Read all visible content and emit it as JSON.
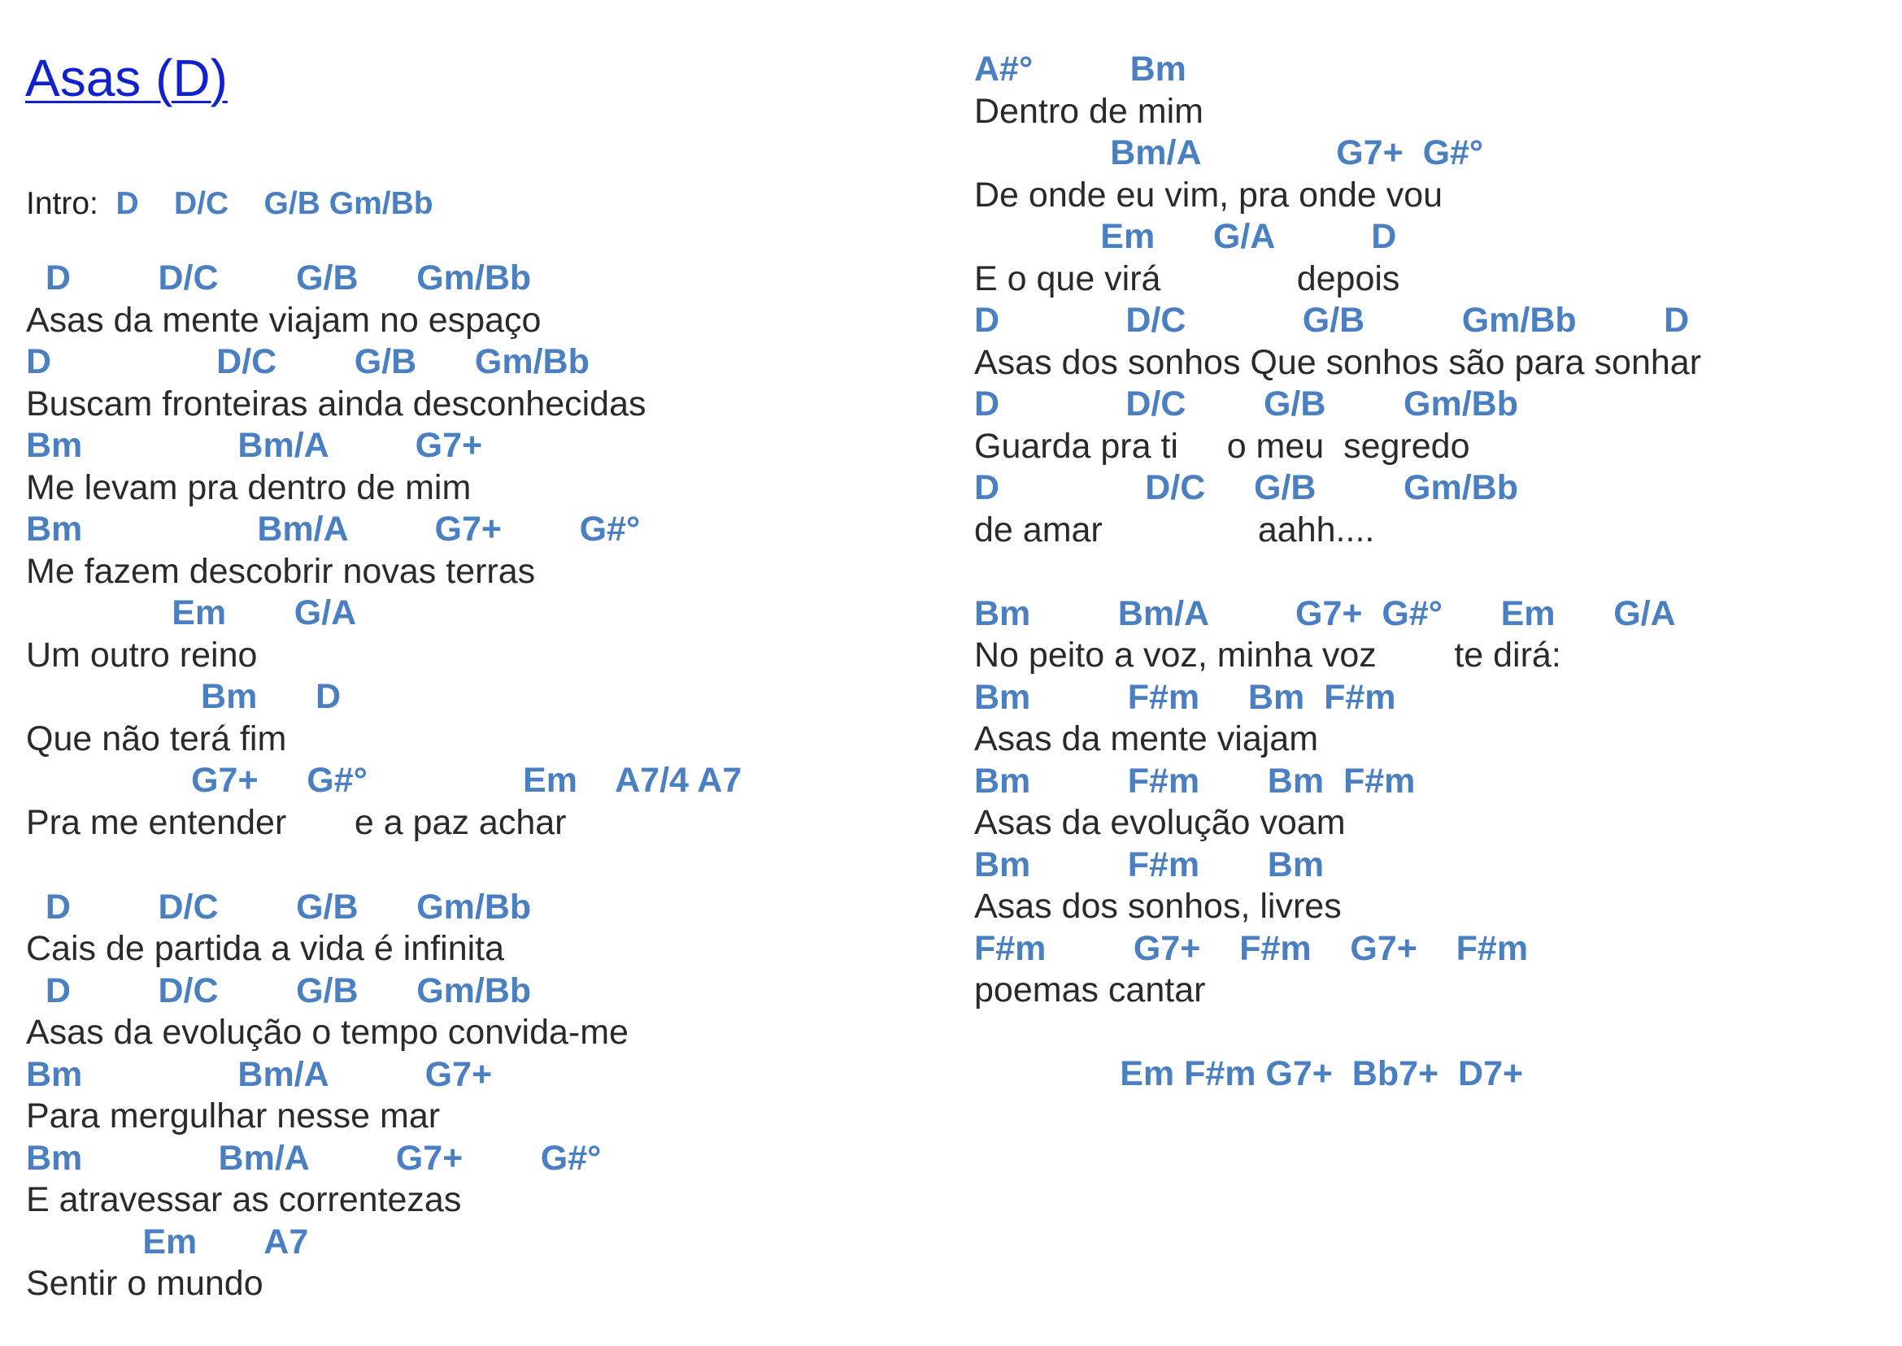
{
  "song": {
    "title": "Asas (D)",
    "intro_label": "Intro:  ",
    "intro_chords": "D    D/C    G/B Gm/Bb"
  },
  "left_column": [
    {
      "type": "chord",
      "text": "  D         D/C        G/B      Gm/Bb"
    },
    {
      "type": "lyric",
      "text": "Asas da mente viajam no espaço"
    },
    {
      "type": "chord",
      "text": "D                 D/C        G/B      Gm/Bb"
    },
    {
      "type": "lyric",
      "text": "Buscam fronteiras ainda desconhecidas"
    },
    {
      "type": "chord",
      "text": "Bm                Bm/A         G7+"
    },
    {
      "type": "lyric",
      "text": "Me levam pra dentro de mim"
    },
    {
      "type": "chord",
      "text": "Bm                  Bm/A         G7+        G#°"
    },
    {
      "type": "lyric",
      "text": "Me fazem descobrir novas terras"
    },
    {
      "type": "chord",
      "text": "               Em       G/A"
    },
    {
      "type": "lyric",
      "text": "Um outro reino"
    },
    {
      "type": "chord",
      "text": "                  Bm      D"
    },
    {
      "type": "lyric",
      "text": "Que não terá fim"
    },
    {
      "type": "chord",
      "text": "                 G7+     G#°                Em    A7/4 A7"
    },
    {
      "type": "lyric",
      "text": "Pra me entender       e a paz achar"
    },
    {
      "type": "chord",
      "text": "  D         D/C        G/B      Gm/Bb"
    },
    {
      "type": "lyric",
      "text": "Cais de partida a vida é infinita"
    },
    {
      "type": "chord",
      "text": "  D         D/C        G/B      Gm/Bb"
    },
    {
      "type": "lyric",
      "text": "Asas da evolução o tempo convida-me"
    },
    {
      "type": "chord",
      "text": "Bm                Bm/A          G7+"
    },
    {
      "type": "lyric",
      "text": "Para mergulhar nesse mar"
    },
    {
      "type": "chord",
      "text": "Bm              Bm/A         G7+        G#°"
    },
    {
      "type": "lyric",
      "text": "E atravessar as correntezas"
    },
    {
      "type": "chord",
      "text": "            Em       A7"
    },
    {
      "type": "lyric",
      "text": "Sentir o mundo"
    }
  ],
  "right_column": [
    {
      "type": "chord",
      "text": "A#°          Bm"
    },
    {
      "type": "lyric",
      "text": "Dentro de mim"
    },
    {
      "type": "chord",
      "text": "              Bm/A              G7+  G#°"
    },
    {
      "type": "lyric",
      "text": "De onde eu vim, pra onde vou"
    },
    {
      "type": "chord",
      "text": "             Em      G/A          D"
    },
    {
      "type": "lyric",
      "text": "E o que virá              depois"
    },
    {
      "type": "chord",
      "text": "D             D/C            G/B          Gm/Bb         D"
    },
    {
      "type": "lyric",
      "text": "Asas dos sonhos Que sonhos são para sonhar"
    },
    {
      "type": "chord",
      "text": "D             D/C        G/B        Gm/Bb"
    },
    {
      "type": "lyric",
      "text": "Guarda pra ti     o meu  segredo"
    },
    {
      "type": "chord",
      "text": "D               D/C     G/B         Gm/Bb"
    },
    {
      "type": "lyric",
      "text": "de amar                aahh...."
    },
    {
      "type": "chord",
      "text": "Bm         Bm/A         G7+  G#°      Em      G/A"
    },
    {
      "type": "lyric",
      "text": "No peito a voz, minha voz        te dirá:"
    },
    {
      "type": "chord",
      "text": "Bm          F#m     Bm  F#m"
    },
    {
      "type": "lyric",
      "text": "Asas da mente viajam"
    },
    {
      "type": "chord",
      "text": "Bm          F#m       Bm  F#m"
    },
    {
      "type": "lyric",
      "text": "Asas da evolução voam"
    },
    {
      "type": "chord",
      "text": "Bm          F#m       Bm"
    },
    {
      "type": "lyric",
      "text": "Asas dos sonhos, livres"
    },
    {
      "type": "chord",
      "text": "F#m         G7+    F#m    G7+    F#m"
    },
    {
      "type": "lyric",
      "text": "poemas cantar"
    },
    {
      "type": "chord",
      "text": "               Em F#m G7+  Bb7+  D7+"
    }
  ]
}
